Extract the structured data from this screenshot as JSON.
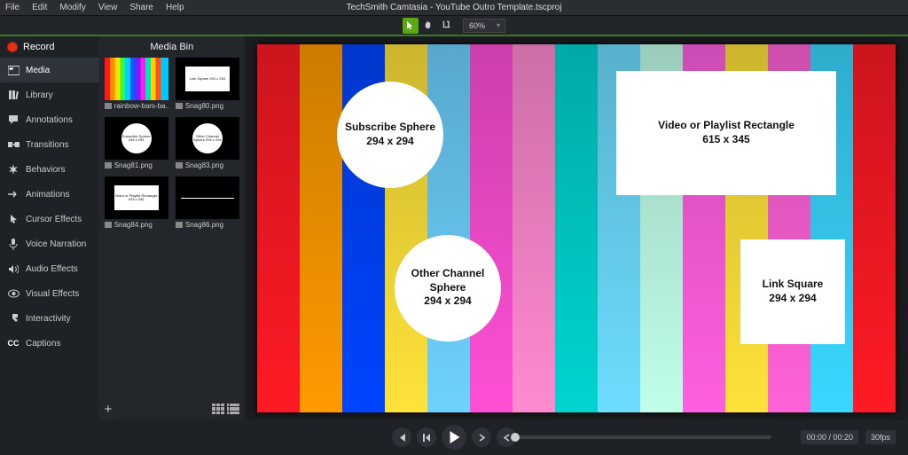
{
  "menu": {
    "items": [
      "File",
      "Edit",
      "Modify",
      "View",
      "Share",
      "Help"
    ],
    "title": "TechSmith Camtasia - YouTube Outro Template.tscproj"
  },
  "toolbar": {
    "zoom": "60%"
  },
  "record_label": "Record",
  "side_tabs": [
    {
      "label": "Media"
    },
    {
      "label": "Library"
    },
    {
      "label": "Annotations"
    },
    {
      "label": "Transitions"
    },
    {
      "label": "Behaviors"
    },
    {
      "label": "Animations"
    },
    {
      "label": "Cursor Effects"
    },
    {
      "label": "Voice Narration"
    },
    {
      "label": "Audio Effects"
    },
    {
      "label": "Visual Effects"
    },
    {
      "label": "Interactivity"
    },
    {
      "label": "Captions"
    }
  ],
  "bin": {
    "title": "Media Bin",
    "items": [
      {
        "name": "rainbow-bars-ba...",
        "thumb_text": ""
      },
      {
        "name": "Snag80.png",
        "thumb_text": "Link Square 294 x 294"
      },
      {
        "name": "Snag81.png",
        "thumb_text": "Subscribe Sphere 294 x 294"
      },
      {
        "name": "Snag83.png",
        "thumb_text": "Other Channel Sphere 294 x 294"
      },
      {
        "name": "Snag84.png",
        "thumb_text": "Video or Playlist Rectangle 615 x 345"
      },
      {
        "name": "Snag86.png",
        "thumb_text": ""
      }
    ]
  },
  "canvas": {
    "bars_colors": [
      "#ff1a25",
      "#ff9a00",
      "#0044ff",
      "#ffe33a",
      "#6ed2ff",
      "#ff4fd6",
      "#ff8ad0",
      "#00d4cf",
      "#6dddff",
      "#c0ffe9",
      "#ff5fe0",
      "#ffe23a",
      "#ff62d8",
      "#3ad7ff",
      "#ff1a25"
    ],
    "subscribe": {
      "title": "Subscribe Sphere",
      "size": "294 x 294"
    },
    "other": {
      "title": "Other Channel Sphere",
      "size": "294 x 294"
    },
    "video": {
      "title": "Video or Playlist Rectangle",
      "size": "615 x 345"
    },
    "link": {
      "title": "Link Square",
      "size": "294 x 294"
    }
  },
  "playback": {
    "time": "00:00 / 00:20",
    "fps": "30fps"
  }
}
